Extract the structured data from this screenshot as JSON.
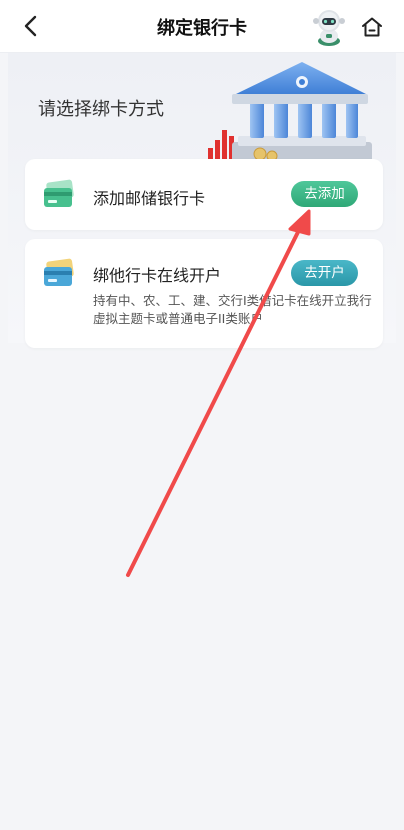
{
  "header": {
    "title": "绑定银行卡",
    "back_icon": "chevron-left-icon",
    "assistant_icon": "robot-assistant-icon",
    "home_icon": "home-icon"
  },
  "hero": {
    "prompt": "请选择绑卡方式",
    "illustration": "bank-building-illustration"
  },
  "options": [
    {
      "label": "添加邮储银行卡",
      "button": "去添加",
      "icon": "green-bank-card-icon",
      "button_color": "#3bb886"
    },
    {
      "label": "绑他行卡在线开户",
      "button": "去开户",
      "description": "持有中、农、工、建、交行I类借记卡在线开立我行虚拟主题卡或普通电子II类账户",
      "icon": "blue-bank-card-icon",
      "button_color": "#36a7b8"
    }
  ],
  "annotation": {
    "type": "red-arrow",
    "color": "#f04a4a"
  }
}
